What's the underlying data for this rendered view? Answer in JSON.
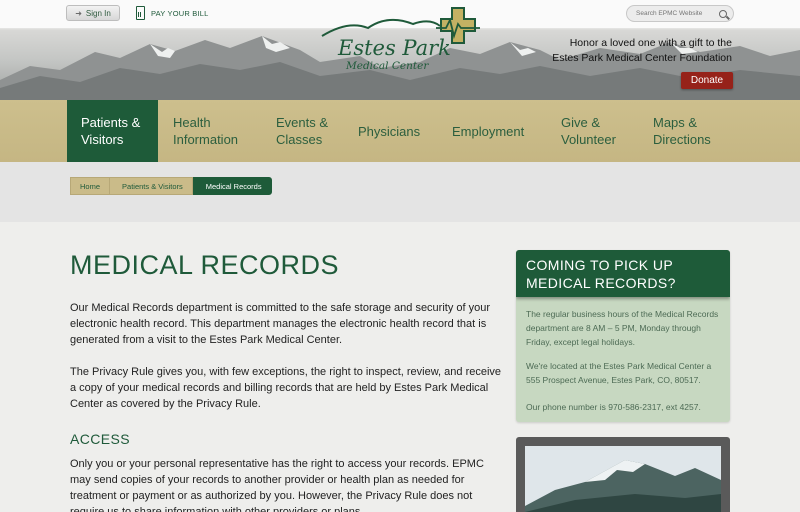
{
  "header": {
    "signin_label": "Sign In",
    "paybill_label": "PAY YOUR BILL",
    "logo_name": "Estes Park",
    "logo_sub": "Medical Center",
    "search_placeholder": "Search EPMC Website",
    "honor_line1": "Honor a loved one with a gift to the",
    "honor_line2": "Estes Park Medical Center Foundation",
    "donate_label": "Donate"
  },
  "nav": {
    "items": [
      {
        "line1": "Patients &",
        "line2": "Visitors"
      },
      {
        "line1": "Health",
        "line2": "Information"
      },
      {
        "line1": "Events &",
        "line2": "Classes"
      },
      {
        "line1": "Physicians",
        "line2": ""
      },
      {
        "line1": "Employment",
        "line2": ""
      },
      {
        "line1": "Give &",
        "line2": "Volunteer"
      },
      {
        "line1": "Maps &",
        "line2": "Directions"
      }
    ]
  },
  "breadcrumb": [
    "Home",
    "Patients & Visitors",
    "Medical Records"
  ],
  "main": {
    "title": "MEDICAL RECORDS",
    "p1": "Our Medical Records department is committed to the safe storage and security of your electronic health record. This department manages the electronic health record that is generated from a visit to the Estes Park Medical Center.",
    "p2": "The Privacy Rule gives you, with few exceptions, the right to inspect, review, and receive a copy of your medical records and billing records that are held by Estes Park Medical Center as covered by the Privacy Rule.",
    "access_heading": "ACCESS",
    "p3": "Only you or your personal representative has the right to access your records. EPMC may send copies of your records to another provider or health plan as needed for treatment or payment or as authorized by you. However, the Privacy Rule does not require us to share information with other providers or plans."
  },
  "sidebar": {
    "heading_line1": "COMING TO PICK UP",
    "heading_line2": "MEDICAL RECORDS?",
    "hours": "The regular business hours of the Medical Records department are 8 AM – 5 PM, Monday through Friday, except legal holidays.",
    "location": "We're located at the Estes Park Medical Center a 555 Prospect Avenue, Estes Park, CO, 80517.",
    "phone": "Our phone number is 970-586-2317, ext 4257."
  },
  "colors": {
    "brand_green": "#1e5b39",
    "nav_tan": "#cabb89",
    "donate_red": "#962219",
    "sidebar_bg": "#c7d8c1"
  }
}
